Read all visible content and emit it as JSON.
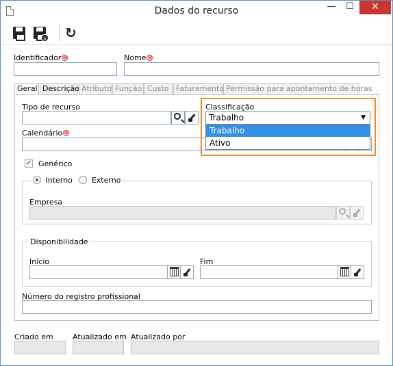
{
  "window": {
    "title": "Dados do recurso",
    "minimize": "—",
    "maximize": "☐",
    "close": "✕"
  },
  "toolbar": {
    "save_icon": "save-icon",
    "save_close_icon": "save-and-close-icon",
    "refresh_icon": "refresh-icon"
  },
  "header": {
    "identificador_label": "Identificador",
    "identificador_value": "",
    "nome_label": "Nome",
    "nome_value": ""
  },
  "tabs": [
    "Geral",
    "Descrição",
    "Atributo",
    "Função",
    "Custo",
    "Faturamento",
    "Permissão para apontamento de horas"
  ],
  "geral": {
    "tipo_recurso_label": "Tipo de recurso",
    "tipo_recurso_value": "",
    "classificacao_label": "Classificação",
    "classificacao_selected": "Trabalho",
    "classificacao_options": [
      "Trabalho",
      "Ativo"
    ],
    "calendario_label": "Calendário",
    "generico_label": "Genérico",
    "generico_checked": true,
    "interno_label": "Interno",
    "externo_label": "Externo",
    "empresa_label": "Empresa",
    "disponibilidade_label": "Disponibilidade",
    "inicio_label": "Início",
    "fim_label": "Fim",
    "registro_label": "Número do registro profissional"
  },
  "footer": {
    "criado_em_label": "Criado em",
    "atualizado_em_label": "Atualizado em",
    "atualizado_por_label": "Atualizado por"
  },
  "colors": {
    "highlight": "#f08a24",
    "selected_option": "#3390e6",
    "close_button": "#c7372f"
  }
}
